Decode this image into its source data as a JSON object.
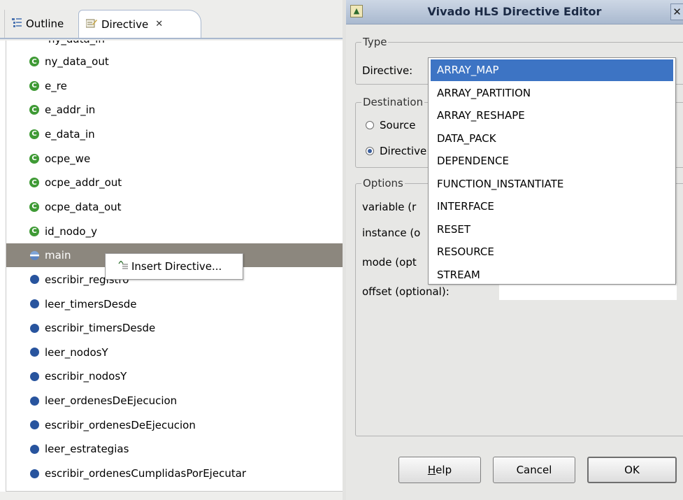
{
  "left_panel": {
    "tabs": [
      {
        "label": "Outline",
        "icon": "outline-icon",
        "active": false
      },
      {
        "label": "Directive",
        "icon": "directive-icon",
        "active": true,
        "close": "✕"
      }
    ],
    "top_fragment": "ny_data_in",
    "items": [
      {
        "label": "ny_data_out",
        "kind": "port"
      },
      {
        "label": "e_re",
        "kind": "port"
      },
      {
        "label": "e_addr_in",
        "kind": "port"
      },
      {
        "label": "e_data_in",
        "kind": "port"
      },
      {
        "label": "ocpe_we",
        "kind": "port"
      },
      {
        "label": "ocpe_addr_out",
        "kind": "port"
      },
      {
        "label": "ocpe_data_out",
        "kind": "port"
      },
      {
        "label": "id_nodo_y",
        "kind": "port"
      },
      {
        "label": "main",
        "kind": "main-function",
        "selected": true
      },
      {
        "label": "escribir_registro",
        "kind": "function"
      },
      {
        "label": "leer_timersDesde",
        "kind": "function"
      },
      {
        "label": "escribir_timersDesde",
        "kind": "function"
      },
      {
        "label": "leer_nodosY",
        "kind": "function"
      },
      {
        "label": "escribir_nodosY",
        "kind": "function"
      },
      {
        "label": "leer_ordenesDeEjecucion",
        "kind": "function"
      },
      {
        "label": "escribir_ordenesDeEjecucion",
        "kind": "function"
      },
      {
        "label": "leer_estrategias",
        "kind": "function"
      },
      {
        "label": "escribir_ordenesCumplidasPorEjecutar",
        "kind": "function"
      }
    ],
    "port_badge": "C",
    "context_menu": {
      "label": "Insert Directive...",
      "icon": "insert-directive-icon"
    }
  },
  "dialog": {
    "title": "Vivado HLS Directive Editor",
    "close_glyph": "✕",
    "type_group": {
      "label": "Type",
      "directive_label": "Directive:"
    },
    "destination_group": {
      "label": "Destination",
      "source_option": "Source",
      "directive_option": "Directive",
      "selected": "directive"
    },
    "options_group": {
      "label": "Options",
      "fields": [
        "variable (r",
        "instance (o",
        "mode (opt",
        "offset (optional):"
      ]
    },
    "dropdown": {
      "selected": "ARRAY_MAP",
      "options": [
        "ARRAY_MAP",
        "ARRAY_PARTITION",
        "ARRAY_RESHAPE",
        "DATA_PACK",
        "DEPENDENCE",
        "FUNCTION_INSTANTIATE",
        "INTERFACE",
        "RESET",
        "RESOURCE",
        "STREAM"
      ]
    },
    "buttons": {
      "help": {
        "mnemonic": "H",
        "rest": "elp"
      },
      "cancel": "Cancel",
      "ok": "OK"
    }
  },
  "colors": {
    "selection_blue": "#3d74c4",
    "tree_selection": "#8c877e",
    "port_green": "#3f9a35",
    "function_blue": "#28549e"
  }
}
